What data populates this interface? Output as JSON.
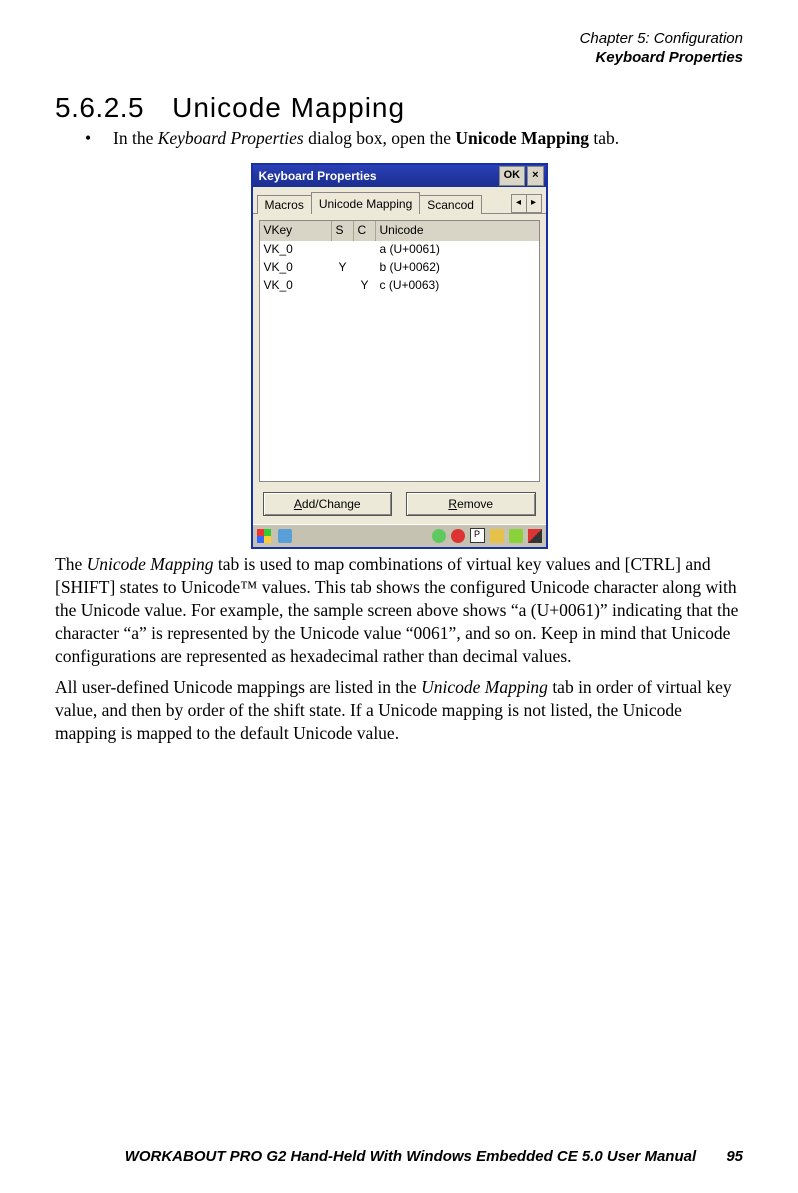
{
  "header": {
    "chapter": "Chapter  5:  Configuration",
    "subject": "Keyboard Properties"
  },
  "section": {
    "number": "5.6.2.5",
    "title": "Unicode  Mapping"
  },
  "bullet": {
    "prefix": "In the ",
    "italic1": "Keyboard Properties",
    "mid": " dialog box, open the ",
    "bold1": "Unicode Mapping",
    "suffix": " tab."
  },
  "dialog": {
    "title": "Keyboard Properties",
    "ok": "OK",
    "close": "×",
    "tabs": {
      "macros": "Macros",
      "unicode": "Unicode Mapping",
      "scancodes": "Scancod"
    },
    "columns": {
      "vkey": "VKey",
      "s": "S",
      "c": "C",
      "unicode": "Unicode"
    },
    "rows": [
      {
        "vkey": "VK_0",
        "s": "",
        "c": "",
        "uni": "a (U+0061)"
      },
      {
        "vkey": "VK_0",
        "s": "Y",
        "c": "",
        "uni": "b (U+0062)"
      },
      {
        "vkey": "VK_0",
        "s": "",
        "c": "Y",
        "uni": "c (U+0063)"
      }
    ],
    "buttons": {
      "add_mn": "A",
      "add_rest": "dd/Change",
      "remove_mn": "R",
      "remove_rest": "emove"
    }
  },
  "para1": {
    "lead": "The ",
    "italic": "Unicode Mapping",
    "rest": " tab is used to map combinations of virtual key values and [CTRL] and [SHIFT] states to Unicode™ values. This tab shows the configured Unicode character along with the Unicode value. For example, the sample screen above shows “a (U+0061)” indicating that the character “a” is represented by the Unicode value “0061”, and so on. Keep in mind that Unicode configurations are represented as hexadecimal rather than decimal values."
  },
  "para2": {
    "a": "All user-defined Unicode mappings are listed in the ",
    "italic": "Unicode Mapping",
    "b": " tab in order of virtual key value, and then by order of the shift state. If a Unicode mapping is not listed, the Unicode mapping is mapped to the default Unicode value."
  },
  "footer": {
    "text": "WORKABOUT PRO G2 Hand-Held With Windows Embedded CE 5.0 User Manual",
    "page": "95"
  }
}
